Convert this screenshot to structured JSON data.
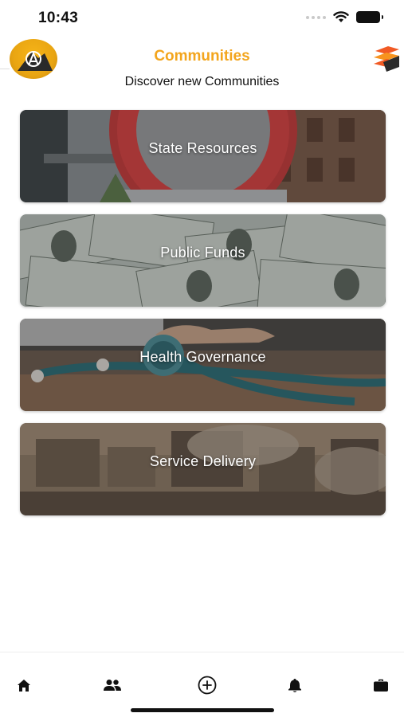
{
  "status_bar": {
    "time": "10:43"
  },
  "header": {
    "title": "Communities",
    "subtitle": "Discover new Communities"
  },
  "communities": [
    {
      "label": "State Resources"
    },
    {
      "label": "Public Funds"
    },
    {
      "label": "Health Governance"
    },
    {
      "label": "Service Delivery"
    }
  ],
  "bottom_nav": [
    {
      "icon": "home-icon"
    },
    {
      "icon": "people-icon"
    },
    {
      "icon": "add-circle-icon"
    },
    {
      "icon": "bell-icon"
    },
    {
      "icon": "briefcase-icon"
    }
  ],
  "colors": {
    "accent": "#f3a51d",
    "text": "#111111",
    "background": "#ffffff"
  }
}
